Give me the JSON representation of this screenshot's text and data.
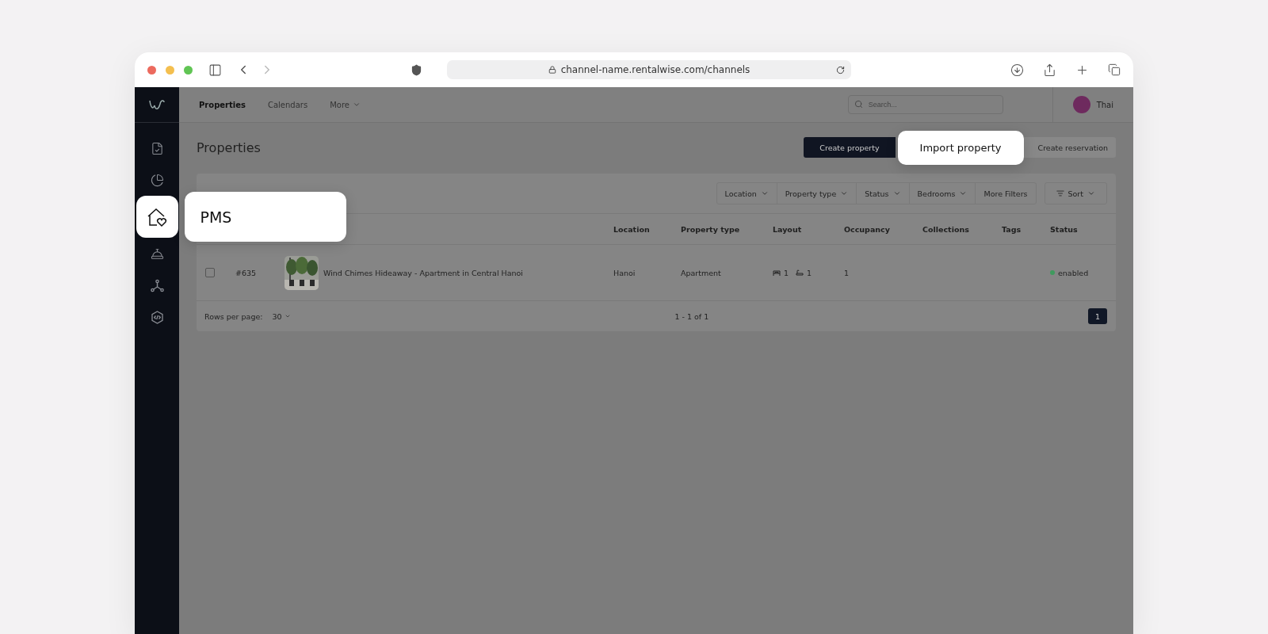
{
  "browser": {
    "url": "channel-name.rentalwise.com/channels"
  },
  "topnav": {
    "items": [
      {
        "label": "Properties",
        "selected": true
      },
      {
        "label": "Calendars",
        "selected": false
      },
      {
        "label": "More",
        "selected": false,
        "caret": true
      }
    ],
    "search": {
      "placeholder": "Search..."
    },
    "user": {
      "name": "Thai"
    }
  },
  "sidebar": {
    "items": [
      {
        "kind": "document",
        "highlighted": false
      },
      {
        "kind": "chart",
        "highlighted": false
      },
      {
        "kind": "home",
        "highlighted": true
      },
      {
        "kind": "bell",
        "highlighted": false
      },
      {
        "kind": "nodes",
        "highlighted": false
      },
      {
        "kind": "code",
        "highlighted": false
      }
    ],
    "callout": "PMS"
  },
  "page": {
    "title": "Properties",
    "actions": [
      {
        "label": "Create property",
        "kind": "primary"
      },
      {
        "label": "Import property",
        "kind": "highlighted"
      },
      {
        "label": "Create reservation",
        "kind": "secondary"
      }
    ]
  },
  "filters": [
    {
      "label": "Location",
      "caret": true
    },
    {
      "label": "Property type",
      "caret": true
    },
    {
      "label": "Status",
      "caret": true
    },
    {
      "label": "Bedrooms",
      "caret": true
    },
    {
      "label": "More Filters",
      "caret": false
    }
  ],
  "sort": {
    "label": "Sort"
  },
  "table": {
    "columns": [
      "Location",
      "Property type",
      "Layout",
      "Occupancy",
      "Collections",
      "Tags",
      "Status"
    ],
    "rows": [
      {
        "checked": false,
        "id": "#635",
        "name": "Wind Chimes Hideaway - Apartment in Central Hanoi",
        "location": "Hanoi",
        "type": "Apartment",
        "bedrooms": "1",
        "bathrooms": "1",
        "occupancy": "1",
        "status": {
          "label": "enabled",
          "color": "#3f9a5e"
        }
      }
    ]
  },
  "footer": {
    "rows_label": "Rows per page:",
    "rows_value": "30",
    "range": "1 - 1 of 1",
    "pages": [
      {
        "label": "1",
        "selected": true
      }
    ]
  }
}
